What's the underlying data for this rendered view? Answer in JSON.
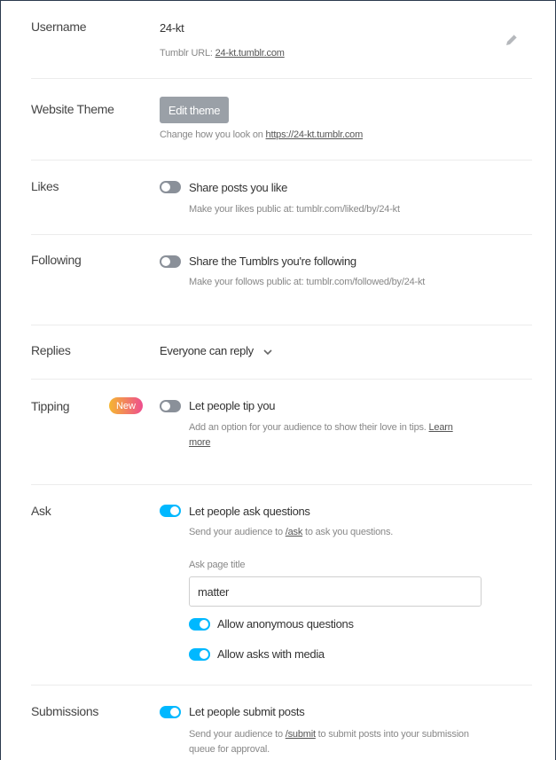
{
  "username": {
    "label": "Username",
    "value": "24-kt",
    "url_prefix": "Tumblr URL:",
    "url": "24-kt.tumblr.com",
    "edit_icon": "pencil-icon"
  },
  "theme": {
    "label": "Website Theme",
    "button": "Edit theme",
    "help_prefix": "Change how you look on",
    "help_link": "https://24-kt.tumblr.com"
  },
  "likes": {
    "label": "Likes",
    "toggle_on": false,
    "toggle_label": "Share posts you like",
    "help": "Make your likes public at: tumblr.com/liked/by/24-kt"
  },
  "following": {
    "label": "Following",
    "toggle_on": false,
    "toggle_label": "Share the Tumblrs you're following",
    "help": "Make your follows public at: tumblr.com/followed/by/24-kt"
  },
  "replies": {
    "label": "Replies",
    "value": "Everyone can reply",
    "icon": "chevron-down-icon"
  },
  "tipping": {
    "label": "Tipping",
    "badge": "New",
    "toggle_on": false,
    "toggle_label": "Let people tip you",
    "help": "Add an option for your audience to show their love in tips.",
    "help_link": "Learn more"
  },
  "ask": {
    "label": "Ask",
    "toggle_on": true,
    "toggle_label": "Let people ask questions",
    "help_prefix": "Send your audience to",
    "help_link": "/ask",
    "help_suffix": "to ask you questions.",
    "page_title_label": "Ask page title",
    "page_title_value": "matter",
    "anon_on": true,
    "anon_label": "Allow anonymous questions",
    "media_on": true,
    "media_label": "Allow asks with media"
  },
  "submissions": {
    "label": "Submissions",
    "toggle_on": true,
    "toggle_label": "Let people submit posts",
    "help_prefix": "Send your audience to",
    "help_link": "/submit",
    "help_suffix": "to submit posts into your submission queue for approval."
  },
  "colors": {
    "toggle_on": "#00b8ff",
    "toggle_off": "#8a9099",
    "button": "#9aa0a7"
  }
}
